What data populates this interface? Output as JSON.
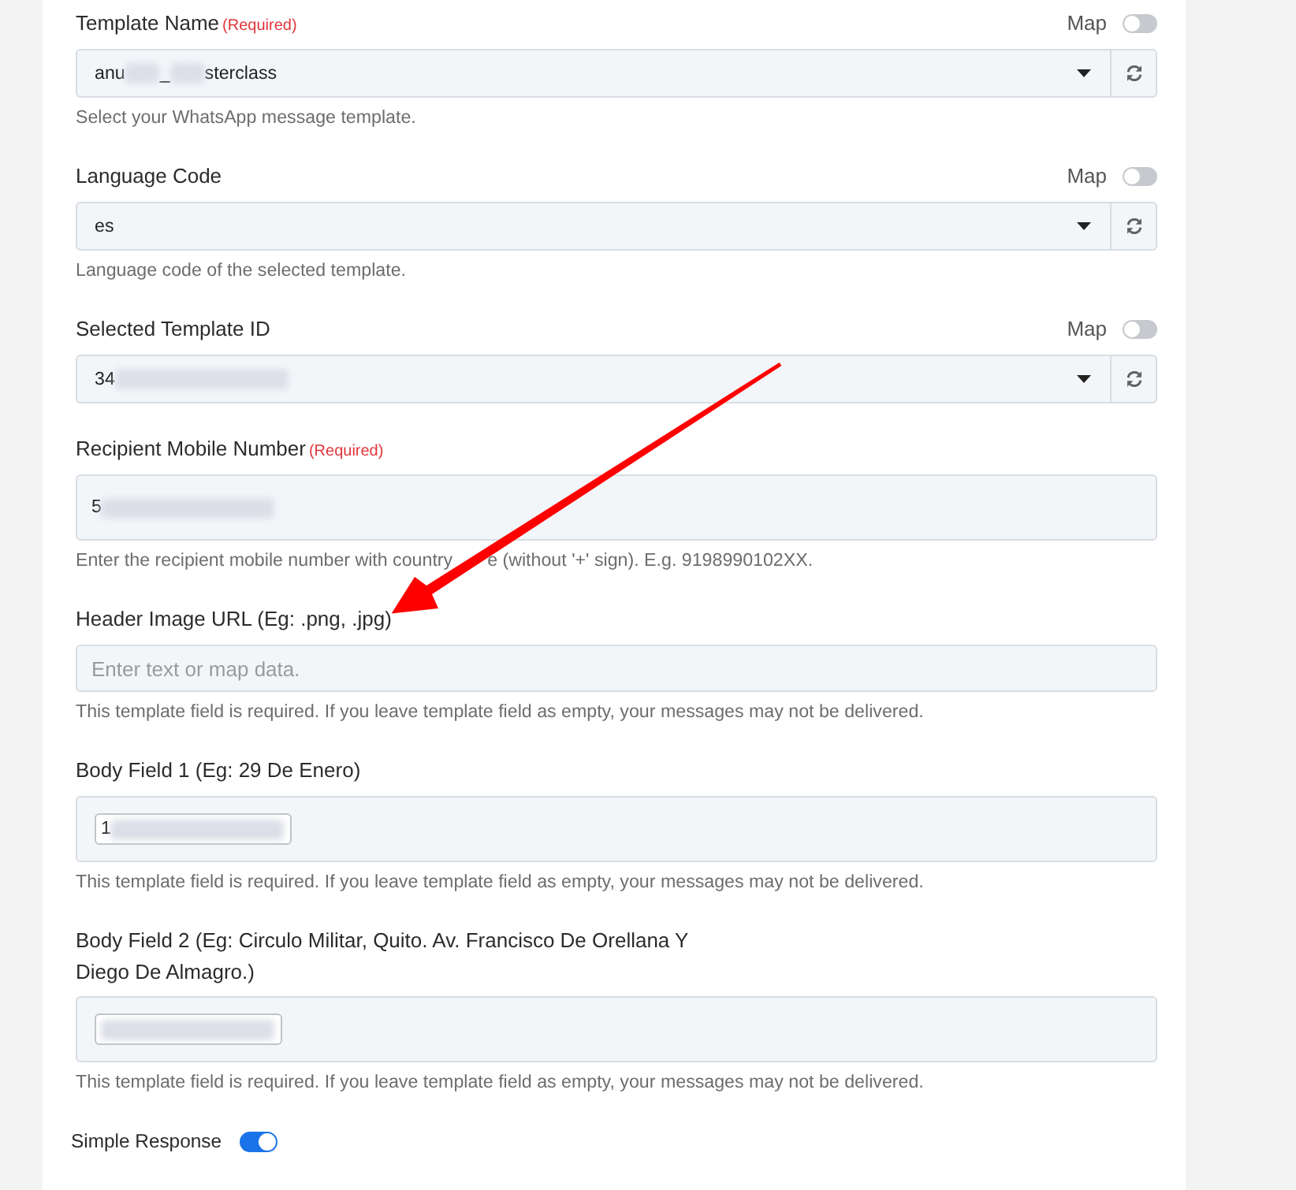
{
  "fields": [
    {
      "kind": "select",
      "label": "Template Name",
      "required_note": "(Required)",
      "map": {
        "label": "Map",
        "on": false
      },
      "value_parts": [
        {
          "kind": "text",
          "text": "anu"
        },
        {
          "kind": "redacted"
        },
        {
          "kind": "text",
          "text": "_"
        },
        {
          "kind": "redacted"
        },
        {
          "kind": "text",
          "text": "sterclass"
        }
      ],
      "help": [
        "Select your WhatsApp message template."
      ]
    },
    {
      "kind": "select",
      "label": "Language Code",
      "map": {
        "label": "Map",
        "on": false
      },
      "value_parts": [
        {
          "kind": "text",
          "text": "es"
        }
      ],
      "help": [
        "Language code of the selected template."
      ]
    },
    {
      "kind": "select",
      "label": "Selected Template ID",
      "map": {
        "label": "Map",
        "on": false
      },
      "value_parts": [
        {
          "kind": "text",
          "text": "34"
        },
        {
          "kind": "redacted"
        }
      ]
    },
    {
      "kind": "mapped",
      "label": "Recipient Mobile Number",
      "required_note": "(Required)",
      "chip": false,
      "value_parts": [
        {
          "kind": "text",
          "text": "5"
        },
        {
          "kind": "redacted"
        }
      ],
      "help": [
        "Enter the recipient mobile number with country",
        "e (without '+' sign). E.g. 9198990102XX."
      ]
    },
    {
      "kind": "input",
      "label": "Header Image URL (Eg: .png, .jpg)",
      "placeholder": "Enter text or map data.",
      "help": [
        "This template field is required. If you leave template field as empty, your messages may not be delivered."
      ]
    },
    {
      "kind": "mapped",
      "label": "Body Field 1 (Eg: 29 De Enero)",
      "chip": true,
      "value_parts": [
        {
          "kind": "text",
          "text": "1"
        },
        {
          "kind": "redacted"
        }
      ],
      "help": [
        "This template field is required. If you leave template field as empty, your messages may not be delivered."
      ]
    },
    {
      "kind": "mapped",
      "label": "Body Field 2 (Eg: Circulo Militar, Quito. Av. Francisco De Orellana Y Diego De Almagro.)",
      "chip": true,
      "value_parts": [
        {
          "kind": "redacted"
        }
      ],
      "help": [
        "This template field is required. If you leave template field as empty, your messages may not be delivered."
      ]
    }
  ],
  "simple_response": {
    "label": "Simple Response",
    "on": true
  },
  "annotations": [
    {
      "kind": "arrow"
    }
  ]
}
